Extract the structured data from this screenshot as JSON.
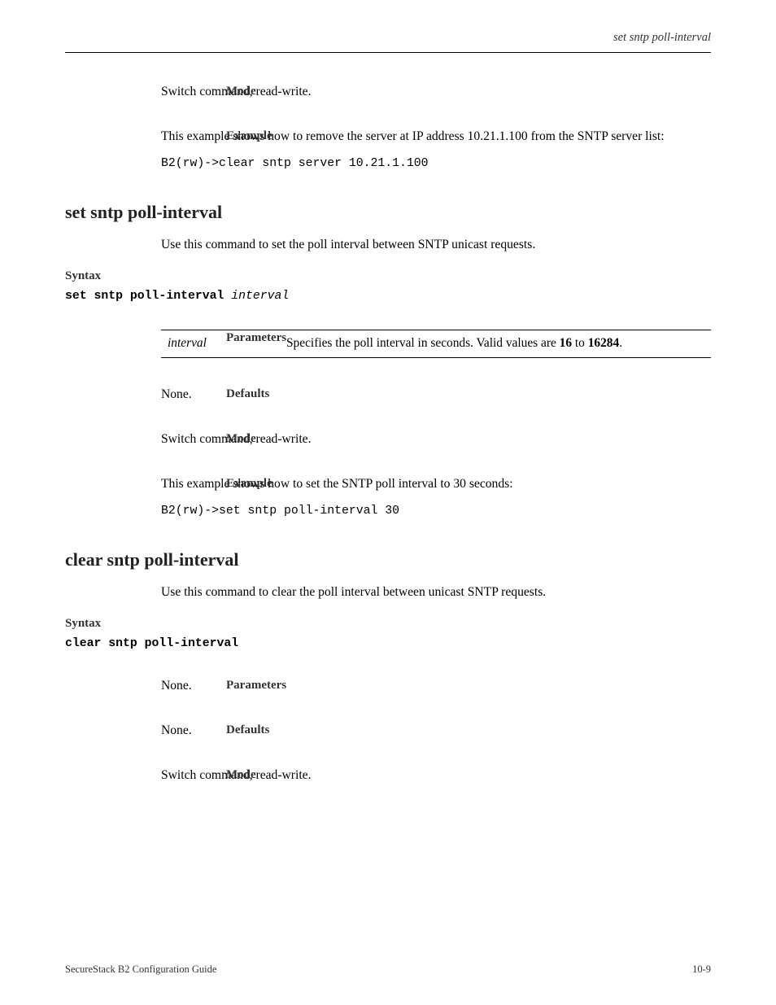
{
  "header": {
    "right": "set sntp poll-interval"
  },
  "s1": {
    "mode_head": "Mode",
    "mode_body": "Switch command, read-write.",
    "ex_head": "Example",
    "ex_body": "This example shows how to remove the server at IP address 10.21.1.100  from the SNTP server list:",
    "ex_cmd": "B2(rw)->clear sntp server 10.21.1.100"
  },
  "cmd_set": {
    "title": "set sntp poll-interval",
    "desc": "Use this command to set the poll interval between SNTP unicast requests.",
    "syn_head": "Syntax",
    "syntax_pre": "set sntp poll-interval ",
    "syntax_arg": "interval",
    "param_head": "Parameters",
    "param_name": "interval",
    "param_pre": "Specifies the poll interval in seconds. Valid values are ",
    "param_b1": "16",
    "param_mid": " to ",
    "param_b2": "16284",
    "param_post": ".",
    "def_head": "Defaults",
    "def_body": "None.",
    "mode_head": "Mode",
    "mode_body": "Switch command, read-write.",
    "ex_head": "Example",
    "ex_body": "This example shows how to set the SNTP poll interval to 30 seconds:",
    "ex_cmd": "B2(rw)->set sntp poll-interval 30"
  },
  "cmd_clear": {
    "title": "clear sntp poll-interval",
    "desc": "Use this command to clear the poll interval between unicast SNTP requests.",
    "syn_head": "Syntax",
    "syntax": "clear sntp poll-interval",
    "param_head": "Parameters",
    "param_body": "None.",
    "def_head": "Defaults",
    "def_body": "None.",
    "mode_head": "Mode",
    "mode_body": "Switch command, read-write."
  },
  "footer": {
    "left": "SecureStack B2 Configuration Guide",
    "right": "10-9"
  }
}
